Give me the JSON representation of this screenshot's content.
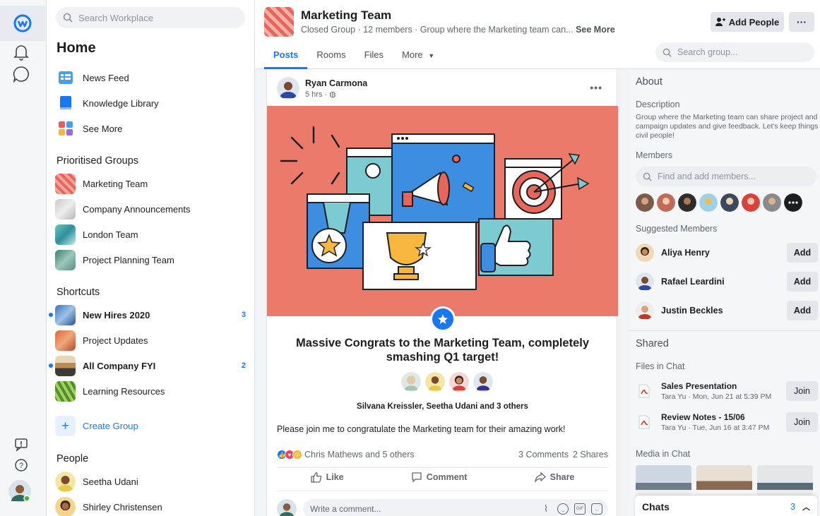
{
  "search": {
    "placeholder": "Search Workplace"
  },
  "nav": {
    "title": "Home",
    "top_items": [
      {
        "label": "News Feed",
        "icon": "news-feed-icon"
      },
      {
        "label": "Knowledge Library",
        "icon": "book-icon"
      },
      {
        "label": "See More",
        "icon": "apps-icon"
      }
    ],
    "prioritised_title": "Prioritised Groups",
    "prioritised": [
      {
        "label": "Marketing Team"
      },
      {
        "label": "Company Announcements"
      },
      {
        "label": "London Team"
      },
      {
        "label": "Project Planning Team"
      }
    ],
    "shortcuts_title": "Shortcuts",
    "shortcuts": [
      {
        "label": "New Hires 2020",
        "count": "3",
        "unread": true
      },
      {
        "label": "Project Updates",
        "count": "",
        "unread": false
      },
      {
        "label": "All Company FYI",
        "count": "2",
        "unread": true
      },
      {
        "label": "Learning Resources",
        "count": "",
        "unread": false
      }
    ],
    "create_group": "Create Group",
    "people_title": "People",
    "people": [
      {
        "label": "Seetha Udani"
      },
      {
        "label": "Shirley Christensen"
      }
    ]
  },
  "group": {
    "title": "Marketing Team",
    "subtitle": "Closed Group · 12 members · Group where the Marketing team can...",
    "see_more": "See More",
    "add_people": "Add People",
    "more": "···",
    "tabs": [
      "Posts",
      "Rooms",
      "Files",
      "More"
    ],
    "search_placeholder": "Search group..."
  },
  "post": {
    "author": "Ryan Carmona",
    "time": "5 hrs ·",
    "headline": "Massive Congrats to the Marketing Team, completely smashing Q1 target!",
    "tagged": "Silvana Kreissler, Seetha Udani and 3 others",
    "body": "Please join me to congratulate the Marketing team for their amazing work!",
    "reactions": "Chris Mathews and 5 others",
    "comments": "3 Comments",
    "shares": "2 Shares",
    "like": "Like",
    "comment": "Comment",
    "share": "Share",
    "comment_placeholder": "Write a comment..."
  },
  "about": {
    "title": "About",
    "description_title": "Description",
    "description": "Group where the Marketing team can share project and campaign updates and give feedback. Let's keep things civil people!",
    "members_title": "Members",
    "members_search": "Find and add members...",
    "suggested_title": "Suggested Members",
    "suggested": [
      {
        "name": "Aliya Henry",
        "action": "Add"
      },
      {
        "name": "Rafael Leardini",
        "action": "Add"
      },
      {
        "name": "Justin Beckles",
        "action": "Add"
      }
    ],
    "shared_title": "Shared",
    "files_title": "Files in Chat",
    "files": [
      {
        "name": "Sales Presentation",
        "meta": "Tara Yu · Mon, Jun 21 at 5:39 PM",
        "action": "Join"
      },
      {
        "name": "Review Notes - 15/06",
        "meta": "Tara Yu · Tue, Jun 16 at 3:47 PM",
        "action": "Join"
      }
    ],
    "media_title": "Media in Chat",
    "chats_label": "Chats",
    "chats_count": "3"
  },
  "colors": {
    "accent": "#1877f2",
    "hero_bg": "#ec7a6a"
  }
}
